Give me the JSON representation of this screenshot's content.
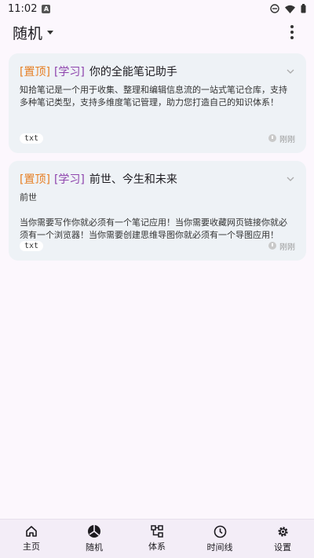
{
  "status_bar": {
    "time": "11:02",
    "notif_letter": "A"
  },
  "app_bar": {
    "title": "随机"
  },
  "notes": [
    {
      "tag_top": "[置顶]",
      "tag_category": "[学习]",
      "title": "你的全能笔记助手",
      "body": "知拾笔记是一个用于收集、整理和编辑信息流的一站式笔记仓库，支持多种笔记类型，支持多维度笔记管理，助力您打造自己的知识体系！",
      "type": "txt",
      "time": "刚刚"
    },
    {
      "tag_top": "[置顶]",
      "tag_category": "[学习]",
      "title": "前世、今生和未来",
      "body": "前世\n\n当你需要写作你就必须有一个笔记应用！当你需要收藏网页链接你就必须有一个浏览器！当你需要创建思维导图你就必须有一个导图应用！",
      "type": "txt",
      "time": "刚刚"
    }
  ],
  "bottom_nav": [
    {
      "label": "主页",
      "icon": "home-icon"
    },
    {
      "label": "随机",
      "icon": "shuffle-icon"
    },
    {
      "label": "体系",
      "icon": "hierarchy-icon"
    },
    {
      "label": "时间线",
      "icon": "clock-icon"
    },
    {
      "label": "设置",
      "icon": "gear-icon"
    }
  ],
  "colors": {
    "tag_top": "#e67e22",
    "tag_category": "#8e44ad",
    "card_bg": "#eef2f6"
  }
}
